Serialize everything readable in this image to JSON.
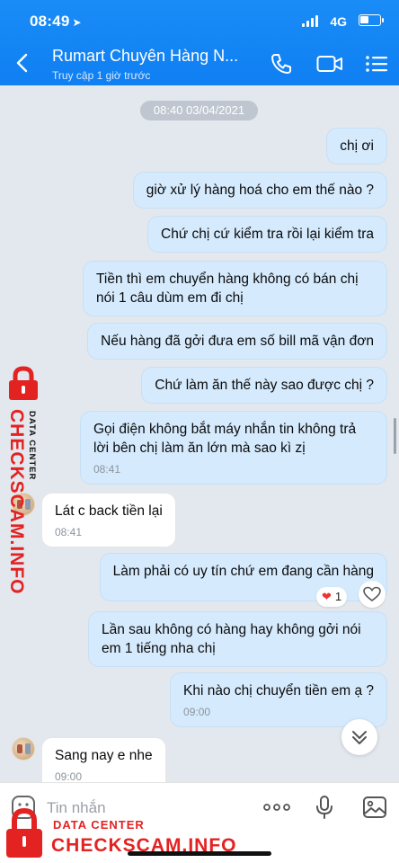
{
  "status_bar": {
    "time": "08:49",
    "network": "4G"
  },
  "header": {
    "contact_name": "Rumart Chuyên Hàng N...",
    "last_seen": "Truy cập 1 giờ trước"
  },
  "chat": {
    "date_separator": "08:40 03/04/2021",
    "messages": [
      {
        "side": "me",
        "text": "chị ơi",
        "time": ""
      },
      {
        "side": "me",
        "text": "giờ xử lý hàng hoá cho em thế nào ?",
        "time": ""
      },
      {
        "side": "me",
        "text": "Chứ chị cứ kiểm tra rồi lại kiểm tra",
        "time": ""
      },
      {
        "side": "me",
        "text": "Tiền thì em chuyển hàng không có bán chị nói 1 câu dùm em đi chị",
        "time": ""
      },
      {
        "side": "me",
        "text": "Nếu hàng đã gởi đưa em số bill mã vận đơn",
        "time": ""
      },
      {
        "side": "me",
        "text": "Chứ làm ăn thế này sao được chị ?",
        "time": ""
      },
      {
        "side": "me",
        "text": "Gọi điện không bắt máy nhắn tin không trả lời bên chị làm ăn lớn mà sao kì zị",
        "time": "08:41"
      },
      {
        "side": "them",
        "text": "Lát c back tiền lại",
        "time": "08:41"
      },
      {
        "side": "me",
        "text": "Làm phải có uy tín chứ em đang cần hàng",
        "time": ""
      },
      {
        "side": "me",
        "text": "Lần sau không có hàng hay không gởi nói em 1 tiếng nha chị",
        "time": ""
      },
      {
        "side": "me",
        "text": "Khi nào chị chuyển tiền em ạ ?",
        "time": "09:00"
      },
      {
        "side": "them",
        "text": "Sang nay e nhe",
        "time": "09:00"
      }
    ],
    "reaction": {
      "emoji": "❤",
      "count": "1"
    }
  },
  "input": {
    "placeholder": "Tin nhắn"
  },
  "watermark": {
    "line1": "DATA CENTER",
    "line2": "CHECKSCAM.INFO"
  },
  "colors": {
    "header": "#0f7ff2",
    "my_bubble": "#d5eafd",
    "watermark": "#e32222"
  }
}
